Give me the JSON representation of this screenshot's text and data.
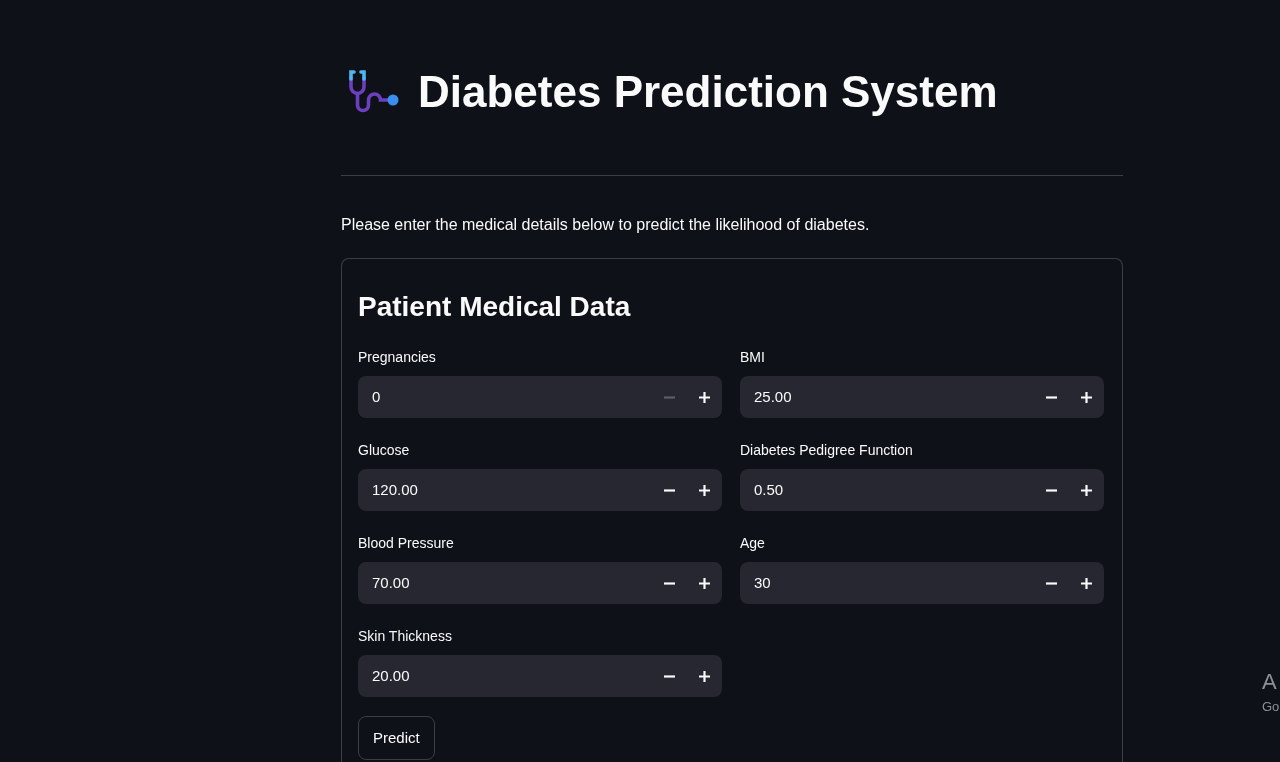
{
  "header": {
    "title": "Diabetes Prediction System"
  },
  "intro": "Please enter the medical details below to predict the likelihood of diabetes.",
  "form": {
    "title": "Patient Medical Data",
    "columns": [
      {
        "fields": [
          {
            "label": "Pregnancies",
            "value": "0",
            "minus_disabled": true
          },
          {
            "label": "Glucose",
            "value": "120.00",
            "minus_disabled": false
          },
          {
            "label": "Blood Pressure",
            "value": "70.00",
            "minus_disabled": false
          },
          {
            "label": "Skin Thickness",
            "value": "20.00",
            "minus_disabled": false
          }
        ]
      },
      {
        "fields": [
          {
            "label": "BMI",
            "value": "25.00",
            "minus_disabled": false
          },
          {
            "label": "Diabetes Pedigree Function",
            "value": "0.50",
            "minus_disabled": false
          },
          {
            "label": "Age",
            "value": "30",
            "minus_disabled": false
          }
        ]
      }
    ],
    "submit": "Predict"
  },
  "system_notice": {
    "line_1": "A",
    "line_2": "Go"
  }
}
